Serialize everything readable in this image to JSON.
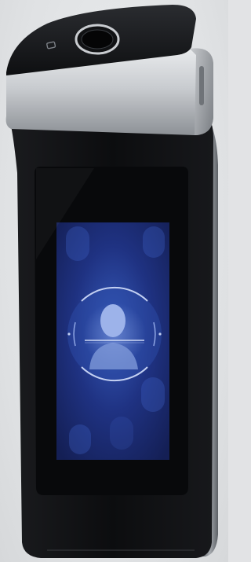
{
  "image": {
    "subject": "face-recognition-terminal",
    "colors": {
      "background": "#e2e3e5",
      "body": "#0f1012",
      "metal": "#c4c7ca",
      "screen": "#1b2a66",
      "screen_glow": "#3f63c9",
      "ring": "#b9c7ea"
    }
  }
}
